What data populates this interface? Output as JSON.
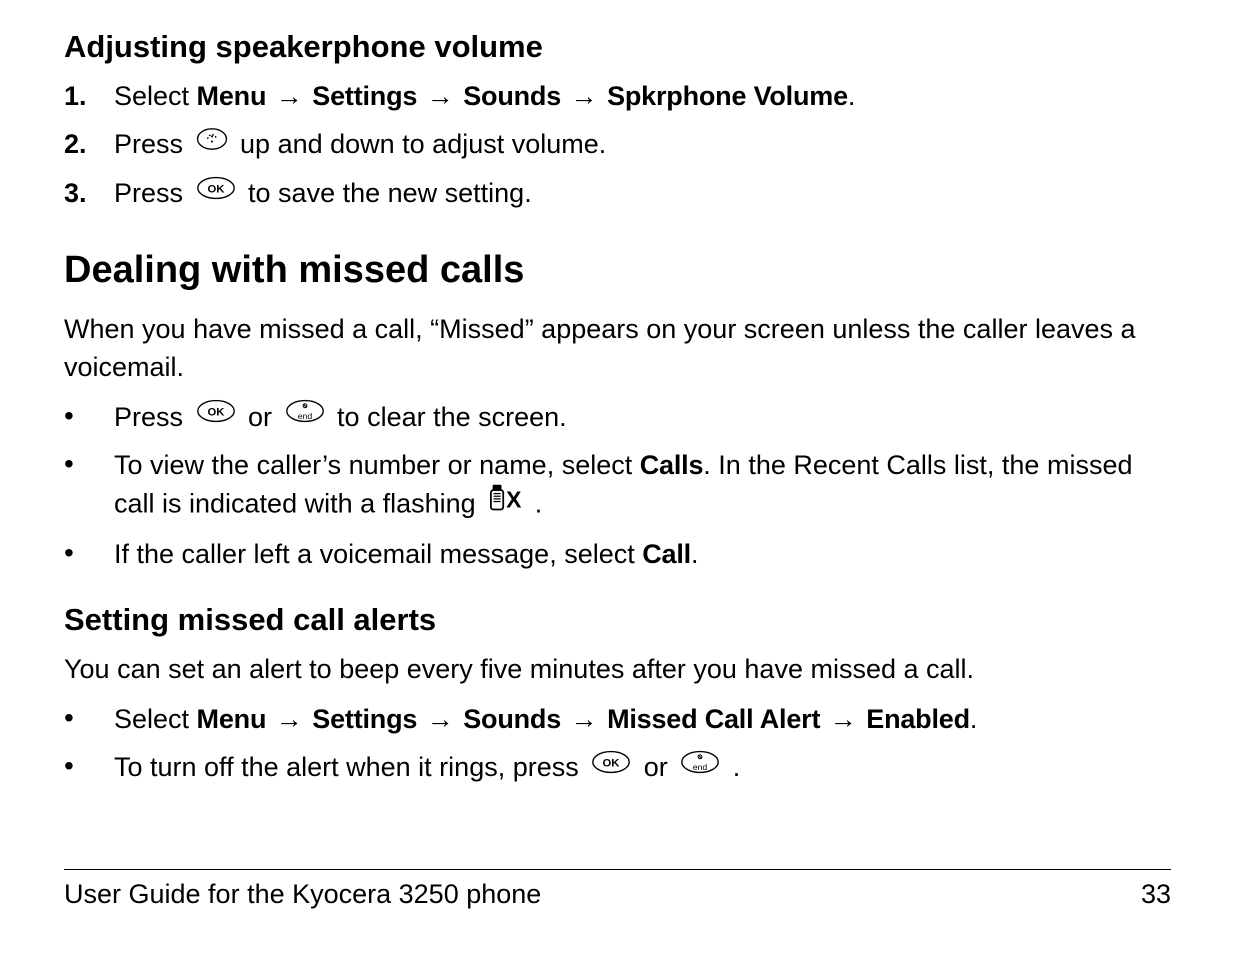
{
  "section1": {
    "heading": "Adjusting speakerphone volume",
    "step1_num": "1.",
    "step1_a": "Select ",
    "step1_menu": "Menu",
    "step1_settings": "Settings",
    "step1_sounds": "Sounds",
    "step1_spkr": "Spkrphone Volume",
    "step1_period": ".",
    "step2_num": "2.",
    "step2_a": "Press ",
    "step2_b": " up and down to adjust volume.",
    "step3_num": "3.",
    "step3_a": "Press ",
    "step3_b": " to save the new setting."
  },
  "section2": {
    "heading": "Dealing with missed calls",
    "intro": "When you have missed a call, “Missed” appears on your screen unless the caller leaves a voicemail.",
    "b1_a": "Press ",
    "b1_b": " or ",
    "b1_c": " to clear the screen.",
    "b2_a": "To view the caller’s number or name, select ",
    "b2_calls": "Calls",
    "b2_b": ". In the Recent Calls list, the missed call is indicated with a flashing ",
    "b2_c": " .",
    "b3_a": "If the caller left a voicemail message, select ",
    "b3_call": "Call",
    "b3_b": "."
  },
  "section3": {
    "heading": "Setting missed call alerts",
    "intro": "You can set an alert to beep every five minutes after you have missed a call.",
    "b1_a": "Select ",
    "b1_menu": "Menu",
    "b1_settings": "Settings",
    "b1_sounds": "Sounds",
    "b1_mca": "Missed Call Alert",
    "b1_enabled": "Enabled",
    "b1_period": ".",
    "b2_a": "To turn off the alert when it rings, press ",
    "b2_b": " or ",
    "b2_c": " ."
  },
  "arrows": {
    "r": "→"
  },
  "bullet": "•",
  "footer": {
    "title": "User Guide for the Kyocera 3250 phone",
    "page": "33"
  }
}
